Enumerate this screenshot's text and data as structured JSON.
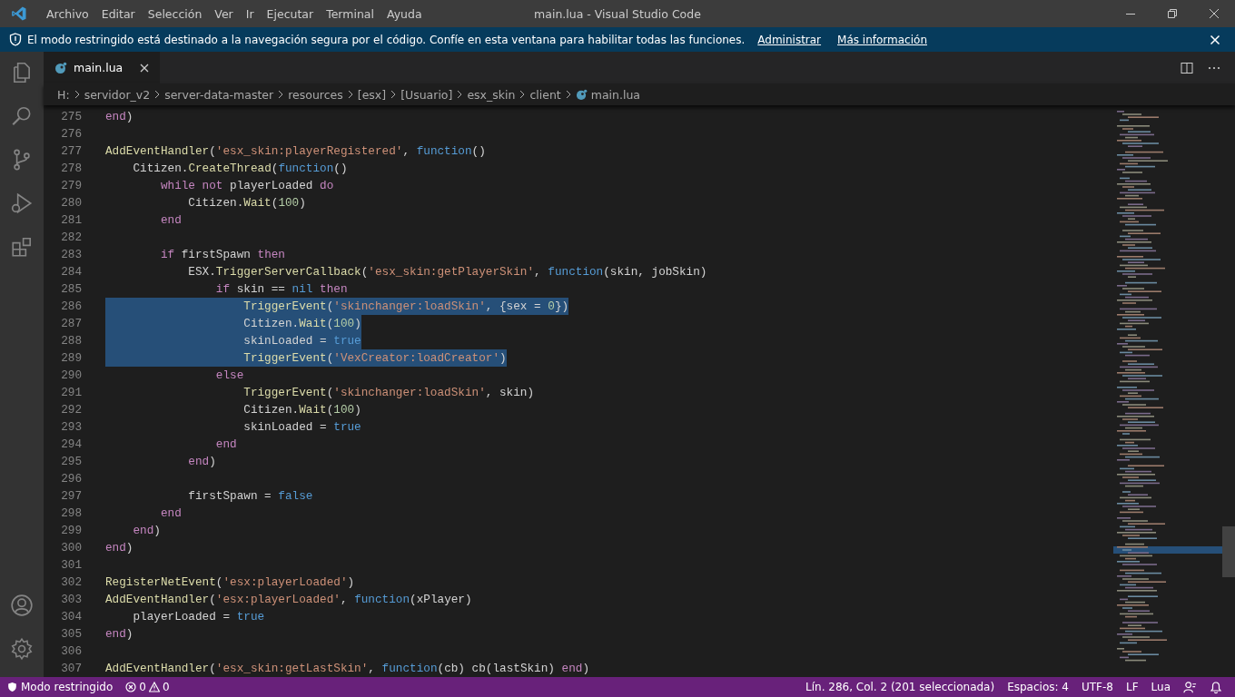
{
  "window": {
    "title": "main.lua - Visual Studio Code"
  },
  "menu": [
    "Archivo",
    "Editar",
    "Selección",
    "Ver",
    "Ir",
    "Ejecutar",
    "Terminal",
    "Ayuda"
  ],
  "banner": {
    "message": "El modo restringido está destinado a la navegación segura por el código. Confíe en esta ventana para habilitar todas las funciones.",
    "links": [
      "Administrar",
      "Más información"
    ]
  },
  "tabs": [
    {
      "label": "main.lua",
      "selected": true
    }
  ],
  "breadcrumb": [
    "H:",
    "servidor_v2",
    "server-data-master",
    "resources",
    "[esx]",
    "[Usuario]",
    "esx_skin",
    "client",
    "main.lua"
  ],
  "code_lines": [
    {
      "number": "275",
      "selected": false,
      "tokens": [
        {
          "kind": "kw",
          "text": "end"
        },
        {
          "kind": "plain",
          "text": ")"
        }
      ]
    },
    {
      "number": "276",
      "selected": false
    },
    {
      "number": "277",
      "selected": false,
      "tokens": [
        {
          "kind": "fn",
          "text": "AddEventHandler"
        },
        {
          "kind": "plain",
          "text": "("
        },
        {
          "kind": "str",
          "text": "'esx_skin:playerRegistered'"
        },
        {
          "kind": "plain",
          "text": ", "
        },
        {
          "kind": "const",
          "text": "function"
        },
        {
          "kind": "plain",
          "text": "()"
        }
      ]
    },
    {
      "number": "278",
      "selected": false,
      "tokens": [
        {
          "kind": "plain",
          "text": "    Citizen."
        },
        {
          "kind": "fn",
          "text": "CreateThread"
        },
        {
          "kind": "plain",
          "text": "("
        },
        {
          "kind": "const",
          "text": "function"
        },
        {
          "kind": "plain",
          "text": "()"
        }
      ]
    },
    {
      "number": "279",
      "selected": false,
      "tokens": [
        {
          "kind": "kw",
          "text": "        while"
        },
        {
          "kind": "kw",
          "text": " not"
        },
        {
          "kind": "plain",
          "text": " playerLoaded "
        },
        {
          "kind": "kw",
          "text": "do"
        }
      ]
    },
    {
      "number": "280",
      "selected": false,
      "tokens": [
        {
          "kind": "plain",
          "text": "            Citizen."
        },
        {
          "kind": "fn",
          "text": "Wait"
        },
        {
          "kind": "plain",
          "text": "("
        },
        {
          "kind": "num",
          "text": "100"
        },
        {
          "kind": "plain",
          "text": ")"
        }
      ]
    },
    {
      "number": "281",
      "selected": false,
      "tokens": [
        {
          "kind": "kw",
          "text": "        end"
        }
      ]
    },
    {
      "number": "282",
      "selected": false
    },
    {
      "number": "283",
      "selected": false,
      "tokens": [
        {
          "kind": "kw",
          "text": "        if"
        },
        {
          "kind": "plain",
          "text": " firstSpawn "
        },
        {
          "kind": "kw",
          "text": "then"
        }
      ]
    },
    {
      "number": "284",
      "selected": false,
      "tokens": [
        {
          "kind": "plain",
          "text": "            ESX."
        },
        {
          "kind": "fn",
          "text": "TriggerServerCallback"
        },
        {
          "kind": "plain",
          "text": "("
        },
        {
          "kind": "str",
          "text": "'esx_skin:getPlayerSkin'"
        },
        {
          "kind": "plain",
          "text": ", "
        },
        {
          "kind": "const",
          "text": "function"
        },
        {
          "kind": "plain",
          "text": "(skin, jobSkin)"
        }
      ]
    },
    {
      "number": "285",
      "selected": false,
      "tokens": [
        {
          "kind": "kw",
          "text": "                if"
        },
        {
          "kind": "plain",
          "text": " skin == "
        },
        {
          "kind": "const",
          "text": "nil"
        },
        {
          "kind": "kw",
          "text": " then"
        }
      ]
    },
    {
      "number": "286",
      "selected": true,
      "tokens": [
        {
          "kind": "fn",
          "text": "                    TriggerEvent"
        },
        {
          "kind": "plain",
          "text": "("
        },
        {
          "kind": "str",
          "text": "'skinchanger:loadSkin'"
        },
        {
          "kind": "plain",
          "text": ", {sex = "
        },
        {
          "kind": "num",
          "text": "0"
        },
        {
          "kind": "plain",
          "text": "})"
        }
      ]
    },
    {
      "number": "287",
      "selected": true,
      "tokens": [
        {
          "kind": "plain",
          "text": "                    Citizen."
        },
        {
          "kind": "fn",
          "text": "Wait"
        },
        {
          "kind": "plain",
          "text": "("
        },
        {
          "kind": "num",
          "text": "100"
        },
        {
          "kind": "plain",
          "text": ")"
        }
      ]
    },
    {
      "number": "288",
      "selected": true,
      "tokens": [
        {
          "kind": "plain",
          "text": "                    skinLoaded = "
        },
        {
          "kind": "const",
          "text": "true"
        }
      ]
    },
    {
      "number": "289",
      "selected": true,
      "tokens": [
        {
          "kind": "fn",
          "text": "                    TriggerEvent"
        },
        {
          "kind": "plain",
          "text": "("
        },
        {
          "kind": "str",
          "text": "'VexCreator:loadCreator'"
        },
        {
          "kind": "plain",
          "text": ")"
        }
      ]
    },
    {
      "number": "290",
      "selected": false,
      "tokens": [
        {
          "kind": "kw",
          "text": "                else"
        }
      ]
    },
    {
      "number": "291",
      "selected": false,
      "tokens": [
        {
          "kind": "fn",
          "text": "                    TriggerEvent"
        },
        {
          "kind": "plain",
          "text": "("
        },
        {
          "kind": "str",
          "text": "'skinchanger:loadSkin'"
        },
        {
          "kind": "plain",
          "text": ", skin)"
        }
      ]
    },
    {
      "number": "292",
      "selected": false,
      "tokens": [
        {
          "kind": "plain",
          "text": "                    Citizen."
        },
        {
          "kind": "fn",
          "text": "Wait"
        },
        {
          "kind": "plain",
          "text": "("
        },
        {
          "kind": "num",
          "text": "100"
        },
        {
          "kind": "plain",
          "text": ")"
        }
      ]
    },
    {
      "number": "293",
      "selected": false,
      "tokens": [
        {
          "kind": "plain",
          "text": "                    skinLoaded = "
        },
        {
          "kind": "const",
          "text": "true"
        }
      ]
    },
    {
      "number": "294",
      "selected": false,
      "tokens": [
        {
          "kind": "kw",
          "text": "                end"
        }
      ]
    },
    {
      "number": "295",
      "selected": false,
      "tokens": [
        {
          "kind": "kw",
          "text": "            end"
        },
        {
          "kind": "plain",
          "text": ")"
        }
      ]
    },
    {
      "number": "296",
      "selected": false
    },
    {
      "number": "297",
      "selected": false,
      "tokens": [
        {
          "kind": "plain",
          "text": "            firstSpawn = "
        },
        {
          "kind": "const",
          "text": "false"
        }
      ]
    },
    {
      "number": "298",
      "selected": false,
      "tokens": [
        {
          "kind": "kw",
          "text": "        end"
        }
      ]
    },
    {
      "number": "299",
      "selected": false,
      "tokens": [
        {
          "kind": "kw",
          "text": "    end"
        },
        {
          "kind": "plain",
          "text": ")"
        }
      ]
    },
    {
      "number": "300",
      "selected": false,
      "tokens": [
        {
          "kind": "kw",
          "text": "end"
        },
        {
          "kind": "plain",
          "text": ")"
        }
      ]
    },
    {
      "number": "301",
      "selected": false
    },
    {
      "number": "302",
      "selected": false,
      "tokens": [
        {
          "kind": "fn",
          "text": "RegisterNetEvent"
        },
        {
          "kind": "plain",
          "text": "("
        },
        {
          "kind": "str",
          "text": "'esx:playerLoaded'"
        },
        {
          "kind": "plain",
          "text": ")"
        }
      ]
    },
    {
      "number": "303",
      "selected": false,
      "tokens": [
        {
          "kind": "fn",
          "text": "AddEventHandler"
        },
        {
          "kind": "plain",
          "text": "("
        },
        {
          "kind": "str",
          "text": "'esx:playerLoaded'"
        },
        {
          "kind": "plain",
          "text": ", "
        },
        {
          "kind": "const",
          "text": "function"
        },
        {
          "kind": "plain",
          "text": "(xPlayer)"
        }
      ]
    },
    {
      "number": "304",
      "selected": false,
      "tokens": [
        {
          "kind": "plain",
          "text": "    playerLoaded = "
        },
        {
          "kind": "const",
          "text": "true"
        }
      ]
    },
    {
      "number": "305",
      "selected": false,
      "tokens": [
        {
          "kind": "kw",
          "text": "end"
        },
        {
          "kind": "plain",
          "text": ")"
        }
      ]
    },
    {
      "number": "306",
      "selected": false
    },
    {
      "number": "307",
      "selected": false,
      "tokens": [
        {
          "kind": "fn",
          "text": "AddEventHandler"
        },
        {
          "kind": "plain",
          "text": "("
        },
        {
          "kind": "str",
          "text": "'esx_skin:getLastSkin'"
        },
        {
          "kind": "plain",
          "text": ", "
        },
        {
          "kind": "const",
          "text": "function"
        },
        {
          "kind": "plain",
          "text": "(cb) cb(lastSkin) "
        },
        {
          "kind": "kw",
          "text": "end"
        },
        {
          "kind": "plain",
          "text": ")"
        }
      ]
    }
  ],
  "status_bar": {
    "mode": "Modo restringido",
    "errors": "0",
    "warnings": "0",
    "items": [
      "Lín. 286, Col. 2 (201 seleccionada)",
      "Espacios: 4",
      "UTF-8",
      "LF",
      "Lua"
    ]
  }
}
